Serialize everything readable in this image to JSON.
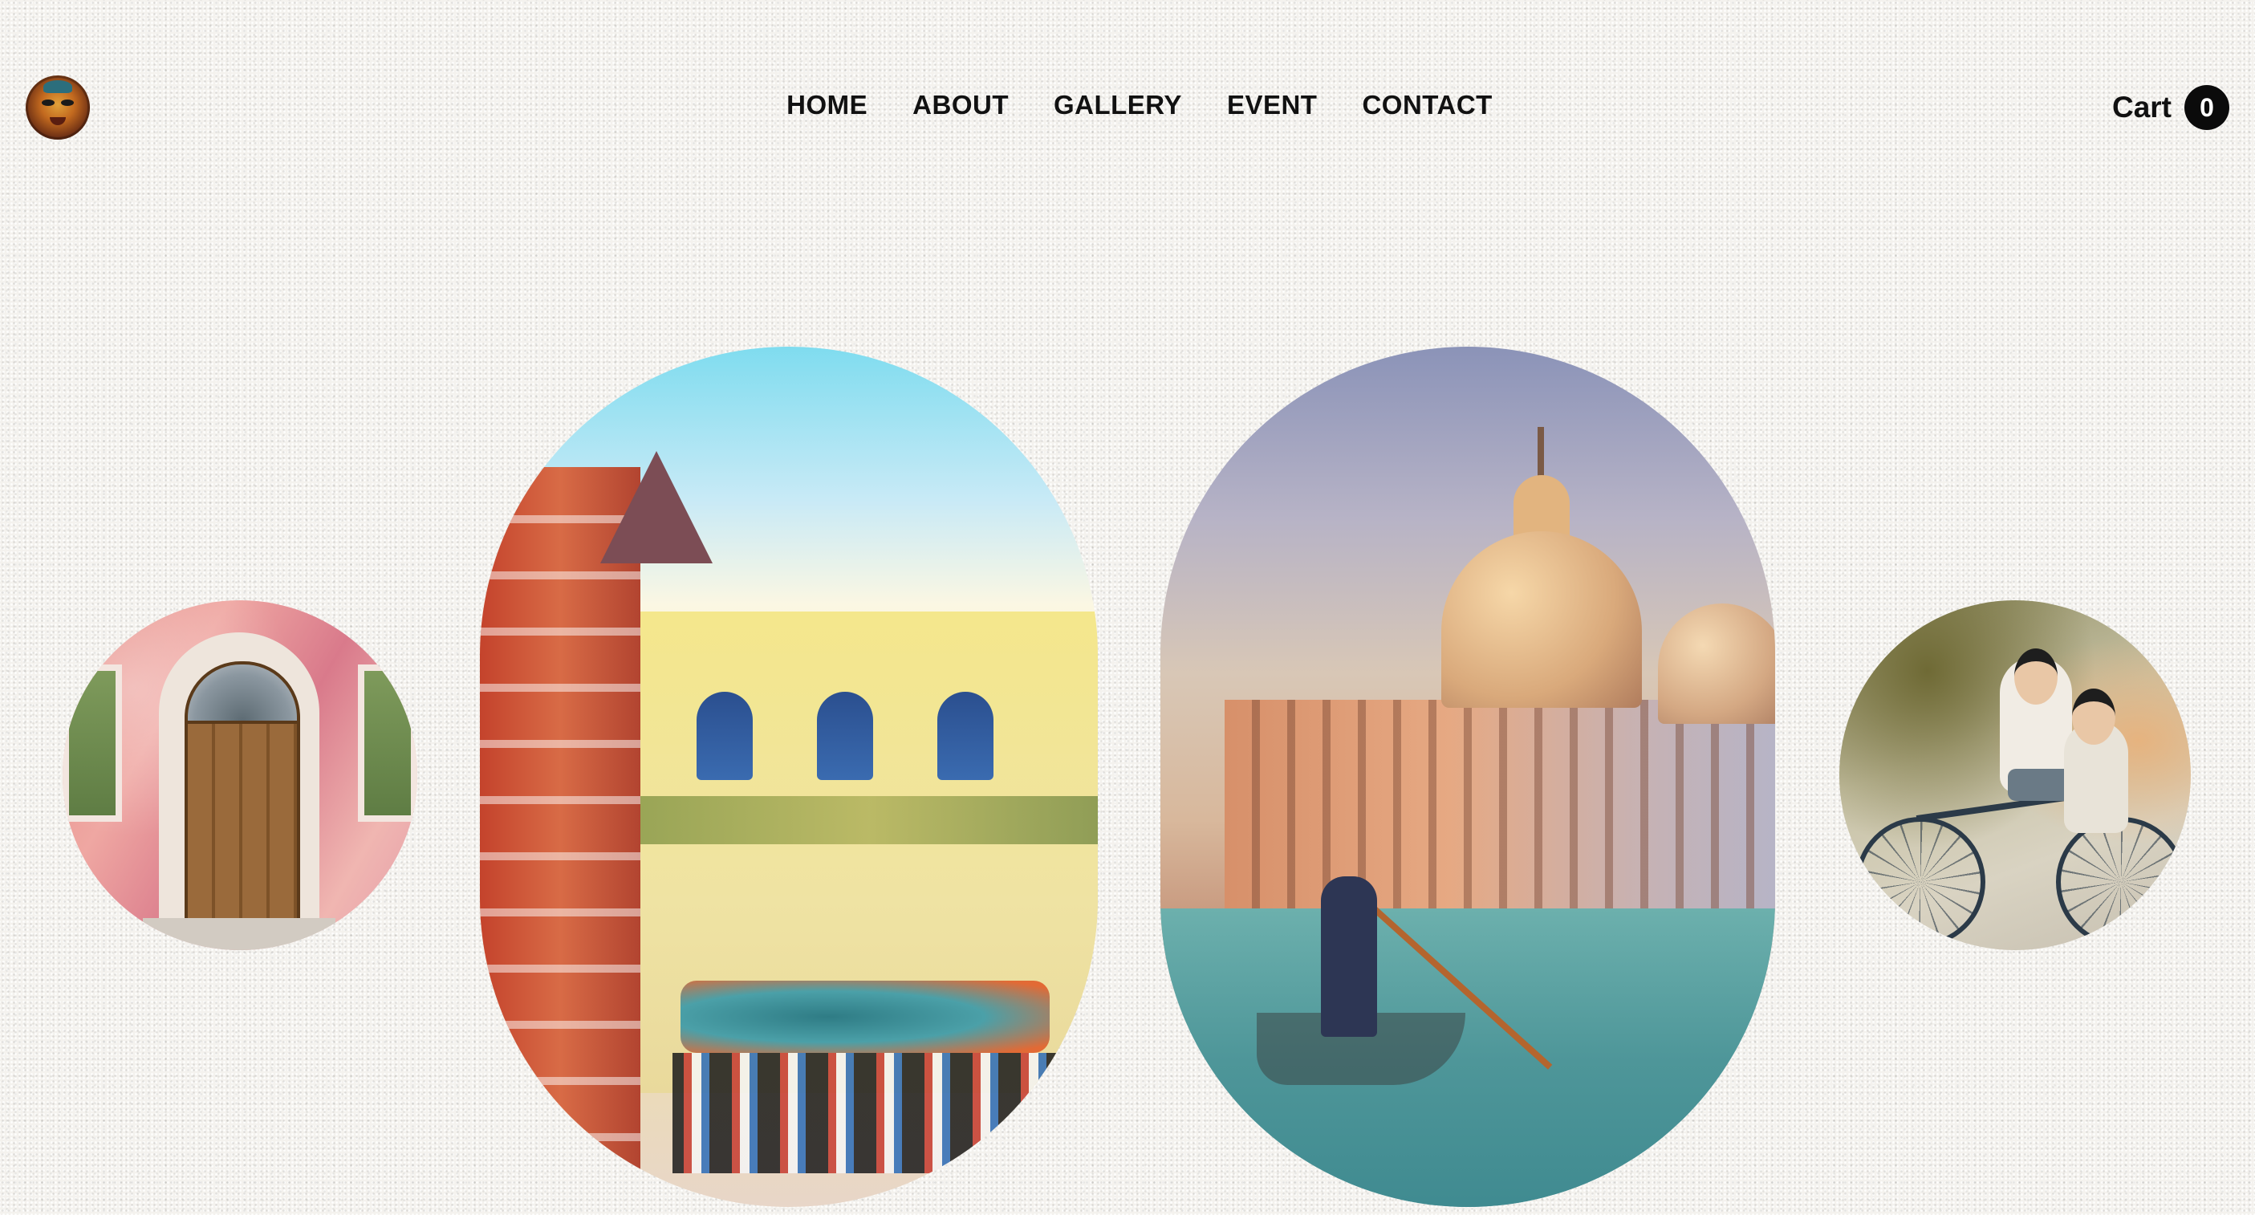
{
  "header": {
    "logo_icon": "tribal-mask-logo",
    "nav": [
      {
        "label": "HOME"
      },
      {
        "label": "ABOUT"
      },
      {
        "label": "GALLERY"
      },
      {
        "label": "EVENT"
      },
      {
        "label": "CONTACT"
      }
    ],
    "cart": {
      "label": "Cart",
      "count": "0"
    }
  },
  "gallery": {
    "items": [
      {
        "subject": "pink-facade-door-watercolor"
      },
      {
        "subject": "colorful-building-street-watercolor"
      },
      {
        "subject": "venice-domes-gondola-watercolor"
      },
      {
        "subject": "kids-on-bicycle-mural"
      }
    ]
  },
  "colors": {
    "background": "#f4f2ee",
    "text": "#111111",
    "cart_badge": "#0b0b0b"
  }
}
